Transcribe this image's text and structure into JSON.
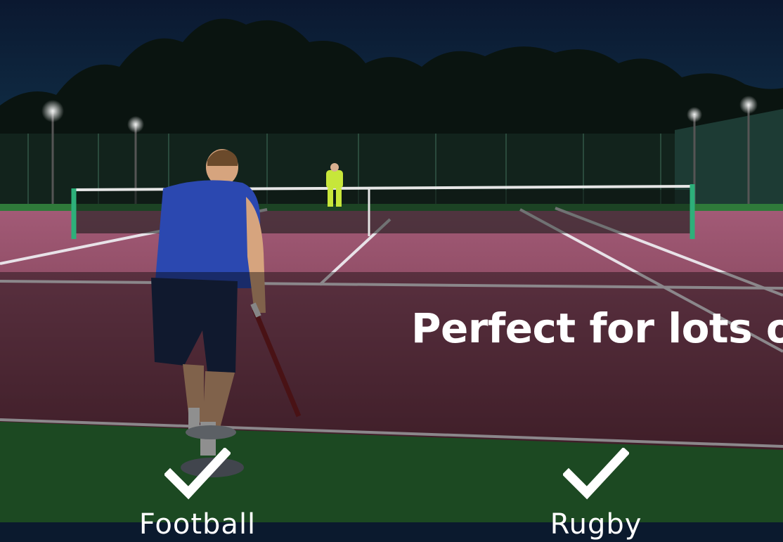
{
  "hero": {
    "headline": "Perfect for lots of"
  },
  "features": [
    {
      "label": "Football",
      "icon": "check-icon"
    },
    {
      "label": "Rugby",
      "icon": "check-icon"
    }
  ],
  "colors": {
    "text": "#ffffff",
    "court": "#7a3d4e",
    "grass": "#2f7a3a",
    "sky": "#0b1a2e"
  }
}
